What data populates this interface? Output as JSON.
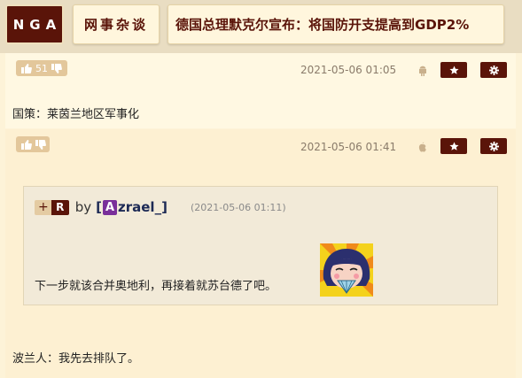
{
  "header": {
    "logo": "NGA",
    "forum": "网事杂谈",
    "topic_title": "德国总理默克尔宣布：将国防开支提高到GDP2%"
  },
  "posts": [
    {
      "likes": "51",
      "date": "2021-05-06 01:05",
      "device_icon": "android-icon",
      "content": "国策：莱茵兰地区军事化"
    },
    {
      "likes": "",
      "date": "2021-05-06 01:41",
      "device_icon": "apple-icon",
      "quote": {
        "plus": "+",
        "tag": "R",
        "by": "by",
        "user_open": "[",
        "user_badge": "A",
        "user_rest": "zrael_",
        "user_close": "]",
        "date": "(2021-05-06 01:11)",
        "text": "下一步就该合并奥地利，再接着就苏台德了吧。"
      },
      "content": "波兰人：我先去排队了。"
    }
  ],
  "colors": {
    "brand": "#5a1409",
    "page_bg": "#fdf3d8",
    "badge_purple": "#7a2f9a"
  }
}
